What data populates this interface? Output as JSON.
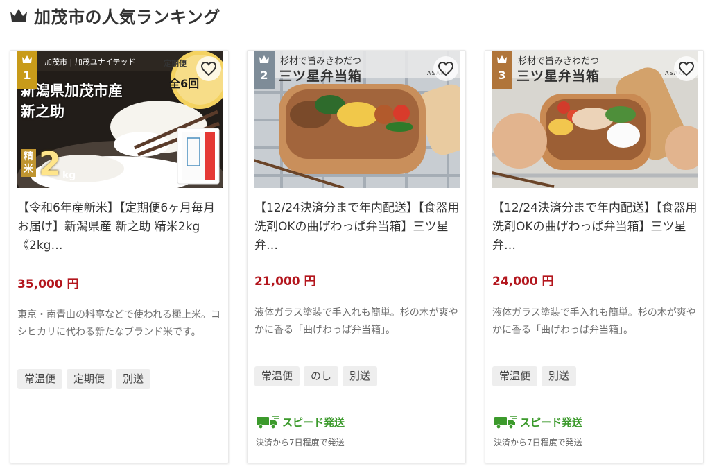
{
  "page": {
    "title": "加茂市の人気ランキング",
    "icon": "crown-icon",
    "colors": {
      "title": "#333333",
      "price": "#b3161d",
      "speed": "#3c9a2c",
      "badge_gold": "#c89b1a",
      "badge_silver": "#7e8c98",
      "badge_bronze": "#b0753a"
    }
  },
  "cards": [
    {
      "rank": "1",
      "badge_color": "#c89b1a",
      "image": {
        "banner": "加茂市 | 加茂ユナイテッド",
        "circle_top": "定期便",
        "circle_bottom": "全6回",
        "headline": "新潟県加茂市産",
        "subline": "新之助",
        "side_label": "精米",
        "weight": "2",
        "unit": "kg"
      },
      "name": "【令和6年産新米】【定期便6ヶ月毎月お届け】新潟県産 新之助 精米2kg《2kg…",
      "price": "35,000 円",
      "description": "東京・南青山の料亭などで使われる極上米。コシヒカリに代わる新たなブランド米です。",
      "tags": [
        "常温便",
        "定期便",
        "別送"
      ],
      "favorite_icon": "heart-icon"
    },
    {
      "rank": "2",
      "badge_color": "#7e8c98",
      "image": {
        "caption_top": "杉材で旨みきわだつ",
        "caption_main": "三ツ星弁当箱",
        "logo": "ASAKI"
      },
      "name": "【12/24決済分まで年内配送】【食器用洗剤OKの曲げわっぱ弁当箱】三ツ星弁…",
      "price": "21,000 円",
      "description": "液体ガラス塗装で手入れも簡単。杉の木が爽やかに香る「曲げわっぱ弁当箱」。",
      "tags": [
        "常温便",
        "のし",
        "別送"
      ],
      "speed_label": "スピード発送",
      "speed_note": "決済から7日程度で発送",
      "favorite_icon": "heart-icon"
    },
    {
      "rank": "3",
      "badge_color": "#b0753a",
      "image": {
        "caption_top": "杉材で旨みきわだつ",
        "caption_main": "三ツ星弁当箱",
        "logo": "ASAKI"
      },
      "name": "【12/24決済分まで年内配送】【食器用洗剤OKの曲げわっぱ弁当箱】三ツ星弁…",
      "price": "24,000 円",
      "description": "液体ガラス塗装で手入れも簡単。杉の木が爽やかに香る「曲げわっぱ弁当箱」。",
      "tags": [
        "常温便",
        "別送"
      ],
      "speed_label": "スピード発送",
      "speed_note": "決済から7日程度で発送",
      "favorite_icon": "heart-icon"
    }
  ]
}
